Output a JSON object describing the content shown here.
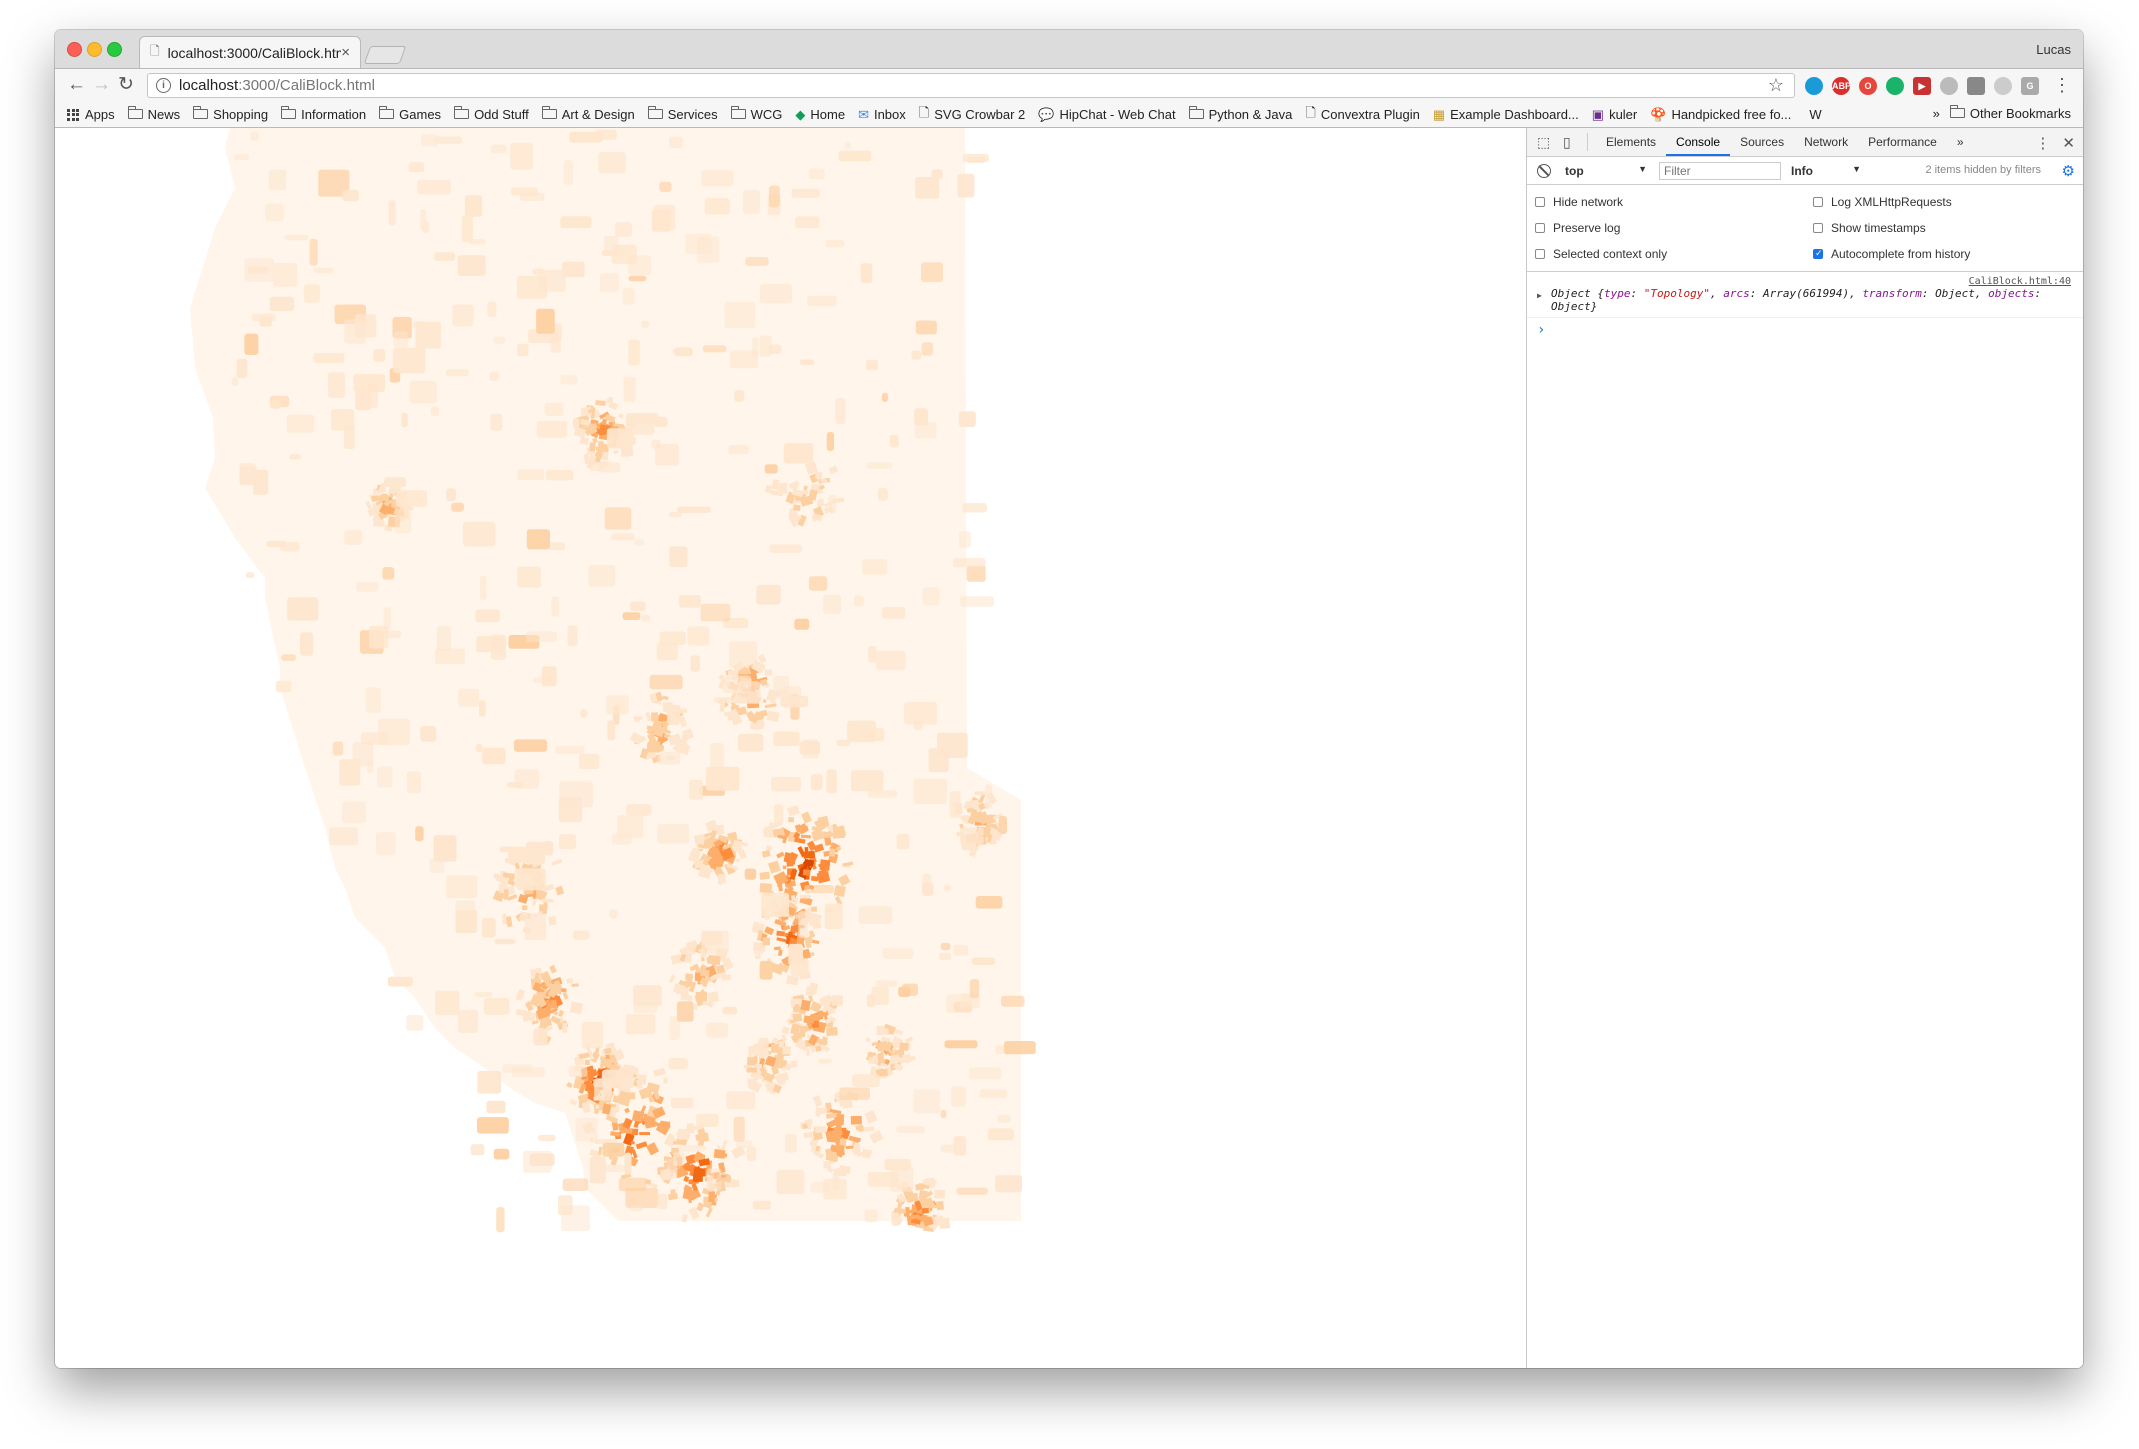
{
  "browser": {
    "tab_title": "localhost:3000/CaliBlock.html",
    "profile": "Lucas",
    "url_host": "localhost",
    "url_rest": ":3000/CaliBlock.html"
  },
  "bookmarks": [
    {
      "label": "Apps",
      "icon": "apps-grid-icon"
    },
    {
      "label": "News",
      "icon": "folder-icon"
    },
    {
      "label": "Shopping",
      "icon": "folder-icon"
    },
    {
      "label": "Information",
      "icon": "folder-icon"
    },
    {
      "label": "Games",
      "icon": "folder-icon"
    },
    {
      "label": "Odd Stuff",
      "icon": "folder-icon"
    },
    {
      "label": "Art & Design",
      "icon": "folder-icon"
    },
    {
      "label": "Services",
      "icon": "folder-icon"
    },
    {
      "label": "WCG",
      "icon": "folder-icon"
    },
    {
      "label": "Home",
      "icon": "diamond-icon"
    },
    {
      "label": "Inbox",
      "icon": "mail-icon"
    },
    {
      "label": "SVG Crowbar 2",
      "icon": "page-icon"
    },
    {
      "label": "HipChat - Web Chat",
      "icon": "chat-icon"
    },
    {
      "label": "Python & Java",
      "icon": "folder-icon"
    },
    {
      "label": "Convextra Plugin",
      "icon": "page-icon"
    },
    {
      "label": "Example Dashboard...",
      "icon": "dashboard-icon"
    },
    {
      "label": "kuler",
      "icon": "kuler-icon"
    },
    {
      "label": "Handpicked free fo...",
      "icon": "mushroom-icon"
    },
    {
      "label": "W",
      "icon": "wikipedia-icon"
    }
  ],
  "other_bookmarks": "Other Bookmarks",
  "devtools": {
    "tabs": [
      "Elements",
      "Console",
      "Sources",
      "Network",
      "Performance"
    ],
    "active_tab": "Console",
    "context": "top",
    "filter_placeholder": "Filter",
    "level": "Info",
    "hidden_count": "2 items hidden by filters",
    "options": [
      {
        "label": "Hide network",
        "checked": false
      },
      {
        "label": "Log XMLHttpRequests",
        "checked": false
      },
      {
        "label": "Preserve log",
        "checked": false
      },
      {
        "label": "Show timestamps",
        "checked": false
      },
      {
        "label": "Selected context only",
        "checked": false
      },
      {
        "label": "Autocomplete from history",
        "checked": true
      }
    ],
    "log": {
      "source": "CaliBlock.html:40",
      "prefix": "Object {",
      "k1": "type",
      "v1": "\"Topology\"",
      "k2": "arcs",
      "v2": "Array(661994)",
      "k3": "transform",
      "v3": "Object",
      "k4": "objects",
      "v4": "Object",
      "suffix": "}"
    }
  },
  "map": {
    "fill_colors": [
      "#fff5eb",
      "#fee6ce",
      "#fdd0a2",
      "#fdae6b",
      "#fd8d3c",
      "#f16913",
      "#d94801"
    ]
  }
}
